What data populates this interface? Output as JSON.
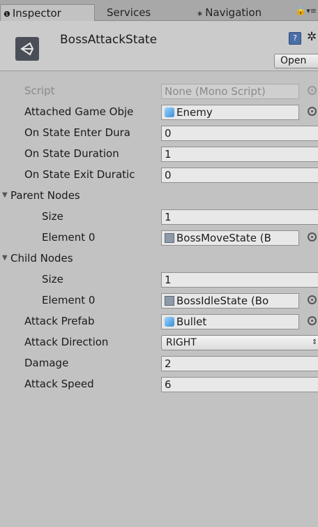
{
  "tabs": {
    "inspector": "Inspector",
    "services": "Services",
    "navigation": "Navigation"
  },
  "header": {
    "title": "BossAttackState",
    "open_label": "Open"
  },
  "fields": {
    "script": {
      "label": "Script",
      "value": "None (Mono Script)"
    },
    "attached": {
      "label": "Attached Game Obje",
      "value": "Enemy"
    },
    "enter": {
      "label": "On State Enter Dura",
      "value": "0"
    },
    "duration": {
      "label": "On State Duration",
      "value": "1"
    },
    "exit": {
      "label": "On State Exit Duratic",
      "value": "0"
    },
    "parent_nodes": {
      "label": "Parent Nodes"
    },
    "parent_size": {
      "label": "Size",
      "value": "1"
    },
    "parent_el0": {
      "label": "Element 0",
      "value": "BossMoveState (B"
    },
    "child_nodes": {
      "label": "Child Nodes"
    },
    "child_size": {
      "label": "Size",
      "value": "1"
    },
    "child_el0": {
      "label": "Element 0",
      "value": "BossIdleState (Bo"
    },
    "attack_prefab": {
      "label": "Attack Prefab",
      "value": "Bullet"
    },
    "attack_direction": {
      "label": "Attack Direction",
      "value": "RIGHT"
    },
    "damage": {
      "label": "Damage",
      "value": "2"
    },
    "attack_speed": {
      "label": "Attack Speed",
      "value": "6"
    }
  }
}
